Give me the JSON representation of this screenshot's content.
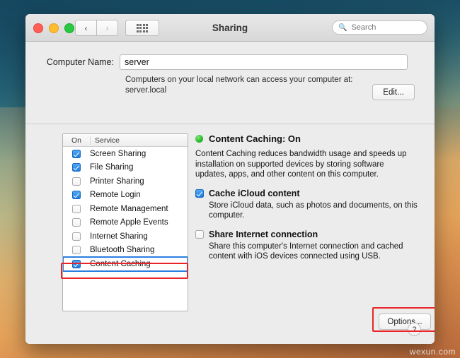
{
  "window": {
    "title": "Sharing",
    "nav": {
      "back": "‹",
      "forward": "›"
    },
    "grid_button": "show-all-grid",
    "search": {
      "placeholder": "Search",
      "value": "",
      "icon": "search-icon"
    }
  },
  "computer_name": {
    "label": "Computer Name:",
    "value": "server",
    "hint_line1": "Computers on your local network can access your computer at:",
    "hint_line2": "server.local",
    "edit_label": "Edit..."
  },
  "service_list": {
    "columns": [
      "On",
      "Service"
    ],
    "rows": [
      {
        "name": "Screen Sharing",
        "checked": true,
        "selected": false
      },
      {
        "name": "File Sharing",
        "checked": true,
        "selected": false
      },
      {
        "name": "Printer Sharing",
        "checked": false,
        "selected": false
      },
      {
        "name": "Remote Login",
        "checked": true,
        "selected": false
      },
      {
        "name": "Remote Management",
        "checked": false,
        "selected": false
      },
      {
        "name": "Remote Apple Events",
        "checked": false,
        "selected": false
      },
      {
        "name": "Internet Sharing",
        "checked": false,
        "selected": false
      },
      {
        "name": "Bluetooth Sharing",
        "checked": false,
        "selected": false
      },
      {
        "name": "Content Caching",
        "checked": true,
        "selected": true
      }
    ]
  },
  "detail": {
    "title": "Content Caching: On",
    "status_color": "#27b927",
    "description": "Content Caching reduces bandwidth usage and speeds up installation on supported devices by storing software updates, apps, and other content on this computer.",
    "options": [
      {
        "label": "Cache iCloud content",
        "checked": true,
        "sub": "Store iCloud data, such as photos and documents, on this computer."
      },
      {
        "label": "Share Internet connection",
        "checked": false,
        "sub": "Share this computer's Internet connection and cached content with iOS devices connected using USB."
      }
    ],
    "options_button": "Options...",
    "help_button": "?"
  },
  "watermark": "wexun.com"
}
